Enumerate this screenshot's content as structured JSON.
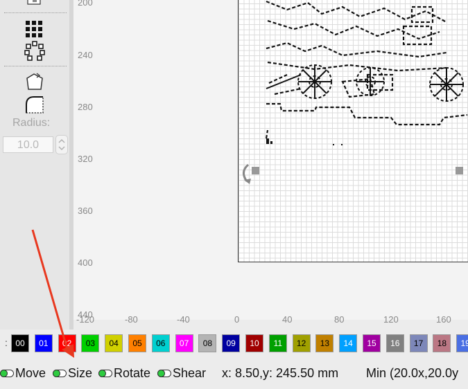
{
  "tools": {
    "grid_icon": "grid-icon",
    "circle_dots_icon": "circle-dots-icon",
    "polygon_icon": "polygon-icon",
    "corner_icon": "round-corner-icon",
    "radius_label": "Radius:",
    "radius_value": "10.0"
  },
  "ruler": {
    "vertical": [
      "200",
      "240",
      "280",
      "320",
      "360",
      "400",
      "440"
    ],
    "horizontal": [
      "-120",
      "-80",
      "-40",
      "0",
      "40",
      "80",
      "120",
      "160"
    ]
  },
  "palette": {
    "colon": ":",
    "swatches": [
      {
        "label": "00",
        "color": "#000000",
        "text": "#ffffff"
      },
      {
        "label": "01",
        "color": "#0000ff",
        "text": "#ffffff"
      },
      {
        "label": "02",
        "color": "#ff0000",
        "text": "#ffffff"
      },
      {
        "label": "03",
        "color": "#00d000",
        "text": "#000000"
      },
      {
        "label": "04",
        "color": "#d0d000",
        "text": "#000000"
      },
      {
        "label": "05",
        "color": "#ff8000",
        "text": "#000000"
      },
      {
        "label": "06",
        "color": "#00d0d0",
        "text": "#000000"
      },
      {
        "label": "07",
        "color": "#ff00ff",
        "text": "#ffffff"
      },
      {
        "label": "08",
        "color": "#b4b4b4",
        "text": "#000000"
      },
      {
        "label": "09",
        "color": "#0000a0",
        "text": "#ffffff"
      },
      {
        "label": "10",
        "color": "#a00000",
        "text": "#ffffff"
      },
      {
        "label": "11",
        "color": "#00a000",
        "text": "#ffffff"
      },
      {
        "label": "12",
        "color": "#a0a000",
        "text": "#000000"
      },
      {
        "label": "13",
        "color": "#c08000",
        "text": "#000000"
      },
      {
        "label": "14",
        "color": "#00a0ff",
        "text": "#ffffff"
      },
      {
        "label": "15",
        "color": "#a000a0",
        "text": "#ffffff"
      },
      {
        "label": "16",
        "color": "#808080",
        "text": "#ffffff"
      },
      {
        "label": "17",
        "color": "#7d87b9",
        "text": "#000000"
      },
      {
        "label": "18",
        "color": "#bb7784",
        "text": "#000000"
      },
      {
        "label": "19",
        "color": "#4a6fe3",
        "text": "#ffffff"
      }
    ]
  },
  "status": {
    "modes": [
      "Move",
      "Size",
      "Rotate",
      "Shear"
    ],
    "coords": "x: 8.50,y: 245.50 mm",
    "min_size": "Min (20.0x,20.0y"
  },
  "annotation_color": "#e8381f"
}
